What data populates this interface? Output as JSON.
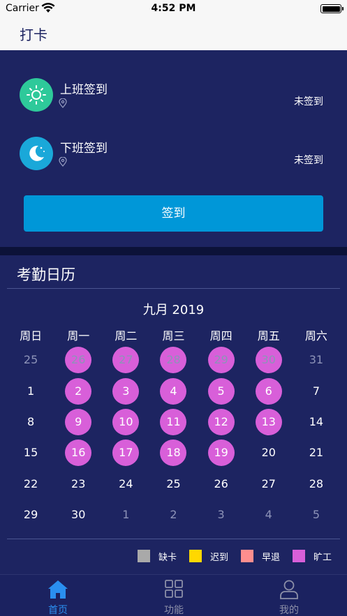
{
  "status_bar": {
    "carrier": "Carrier",
    "time": "4:52 PM"
  },
  "nav": {
    "title": "打卡"
  },
  "checkin": {
    "on_duty": {
      "label": "上班签到",
      "status": "未签到",
      "icon": "sun-icon"
    },
    "off_duty": {
      "label": "下班签到",
      "status": "未签到",
      "icon": "moon-icon"
    },
    "button_label": "签到"
  },
  "calendar": {
    "title": "考勤日历",
    "month_label": "九月 2019",
    "weekdays": [
      "周日",
      "周一",
      "周二",
      "周三",
      "周四",
      "周五",
      "周六"
    ],
    "weeks": [
      [
        {
          "d": "25",
          "c": false,
          "a": false
        },
        {
          "d": "26",
          "c": false,
          "a": true
        },
        {
          "d": "27",
          "c": false,
          "a": true
        },
        {
          "d": "28",
          "c": false,
          "a": true
        },
        {
          "d": "29",
          "c": false,
          "a": true
        },
        {
          "d": "30",
          "c": false,
          "a": true
        },
        {
          "d": "31",
          "c": false,
          "a": false
        }
      ],
      [
        {
          "d": "1",
          "c": true,
          "a": false
        },
        {
          "d": "2",
          "c": true,
          "a": true
        },
        {
          "d": "3",
          "c": true,
          "a": true
        },
        {
          "d": "4",
          "c": true,
          "a": true
        },
        {
          "d": "5",
          "c": true,
          "a": true
        },
        {
          "d": "6",
          "c": true,
          "a": true
        },
        {
          "d": "7",
          "c": true,
          "a": false
        }
      ],
      [
        {
          "d": "8",
          "c": true,
          "a": false
        },
        {
          "d": "9",
          "c": true,
          "a": true
        },
        {
          "d": "10",
          "c": true,
          "a": true
        },
        {
          "d": "11",
          "c": true,
          "a": true
        },
        {
          "d": "12",
          "c": true,
          "a": true
        },
        {
          "d": "13",
          "c": true,
          "a": true
        },
        {
          "d": "14",
          "c": true,
          "a": false
        }
      ],
      [
        {
          "d": "15",
          "c": true,
          "a": false
        },
        {
          "d": "16",
          "c": true,
          "a": true
        },
        {
          "d": "17",
          "c": true,
          "a": true
        },
        {
          "d": "18",
          "c": true,
          "a": true
        },
        {
          "d": "19",
          "c": true,
          "a": true
        },
        {
          "d": "20",
          "c": true,
          "a": false
        },
        {
          "d": "21",
          "c": true,
          "a": false
        }
      ],
      [
        {
          "d": "22",
          "c": true,
          "a": false
        },
        {
          "d": "23",
          "c": true,
          "a": false
        },
        {
          "d": "24",
          "c": true,
          "a": false
        },
        {
          "d": "25",
          "c": true,
          "a": false
        },
        {
          "d": "26",
          "c": true,
          "a": false
        },
        {
          "d": "27",
          "c": true,
          "a": false
        },
        {
          "d": "28",
          "c": true,
          "a": false
        }
      ],
      [
        {
          "d": "29",
          "c": true,
          "a": false
        },
        {
          "d": "30",
          "c": true,
          "a": false
        },
        {
          "d": "1",
          "c": false,
          "a": false
        },
        {
          "d": "2",
          "c": false,
          "a": false
        },
        {
          "d": "3",
          "c": false,
          "a": false
        },
        {
          "d": "4",
          "c": false,
          "a": false
        },
        {
          "d": "5",
          "c": false,
          "a": false
        }
      ]
    ],
    "legend": [
      {
        "label": "缺卡",
        "color": "#a9a9a9"
      },
      {
        "label": "迟到",
        "color": "#ffd800"
      },
      {
        "label": "早退",
        "color": "#ff8e8e"
      },
      {
        "label": "旷工",
        "color": "#d85fd9"
      }
    ]
  },
  "tabs": [
    {
      "label": "首页",
      "icon": "home-icon",
      "active": true
    },
    {
      "label": "功能",
      "icon": "grid-icon",
      "active": false
    },
    {
      "label": "我的",
      "icon": "user-icon",
      "active": false
    }
  ],
  "colors": {
    "accent": "#0097d8",
    "absent": "#d85fd9",
    "tab_active": "#2a8ff0"
  }
}
